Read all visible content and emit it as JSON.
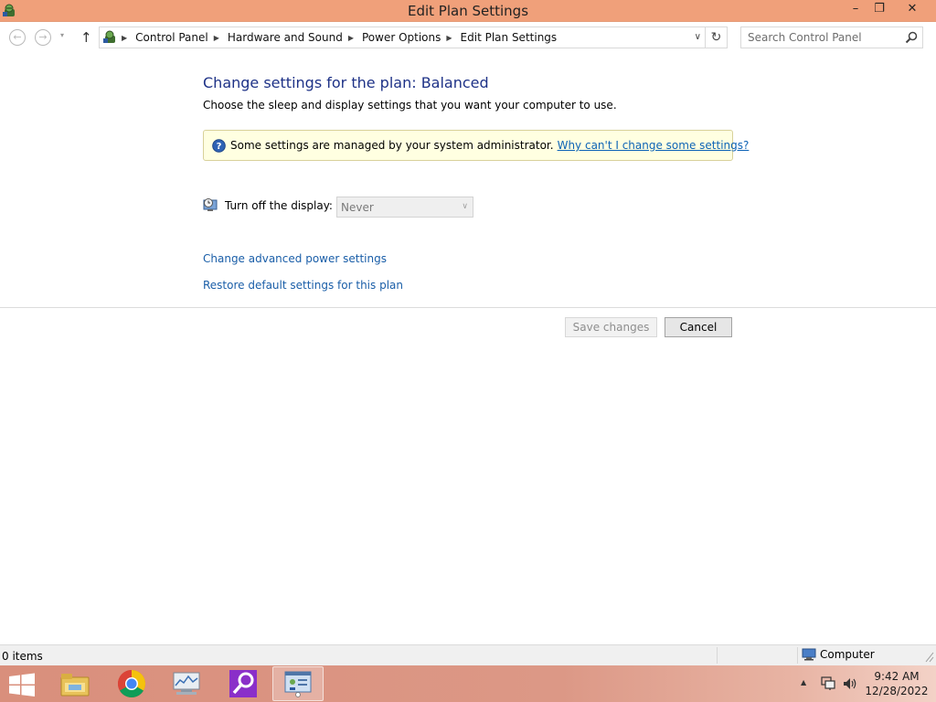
{
  "window": {
    "title": "Edit Plan Settings",
    "minimize_glyph": "–",
    "maximize_glyph": "❐",
    "close_glyph": "✕"
  },
  "nav": {
    "back_glyph": "←",
    "forward_glyph": "→",
    "recent_glyph": "▾",
    "up_glyph": "↑",
    "breadcrumbs": [
      "Control Panel",
      "Hardware and Sound",
      "Power Options",
      "Edit Plan Settings"
    ],
    "dropdown_glyph": "∨",
    "refresh_glyph": "↻",
    "search_placeholder": "Search Control Panel"
  },
  "content": {
    "title": "Change settings for the plan: Balanced",
    "subtitle": "Choose the sleep and display settings that you want your computer to use.",
    "info_text": "Some settings are managed by your system administrator.",
    "info_link": "Why can't I change some settings?",
    "display_label": "Turn off the display:",
    "display_value": "Never",
    "display_caret": "∨",
    "advanced_link": "Change advanced power settings",
    "restore_link": "Restore default settings for this plan",
    "save_button": "Save changes",
    "cancel_button": "Cancel"
  },
  "statusbar": {
    "items": "0 items",
    "location": "Computer"
  },
  "taskbar": {
    "tray_arrow": "▲",
    "time": "9:42 AM",
    "date": "12/28/2022"
  },
  "colors": {
    "titlebar": "#f0a07a",
    "title_text": "#1e3287",
    "link": "#1a5ea8",
    "infobar_bg": "#ffffe1"
  }
}
